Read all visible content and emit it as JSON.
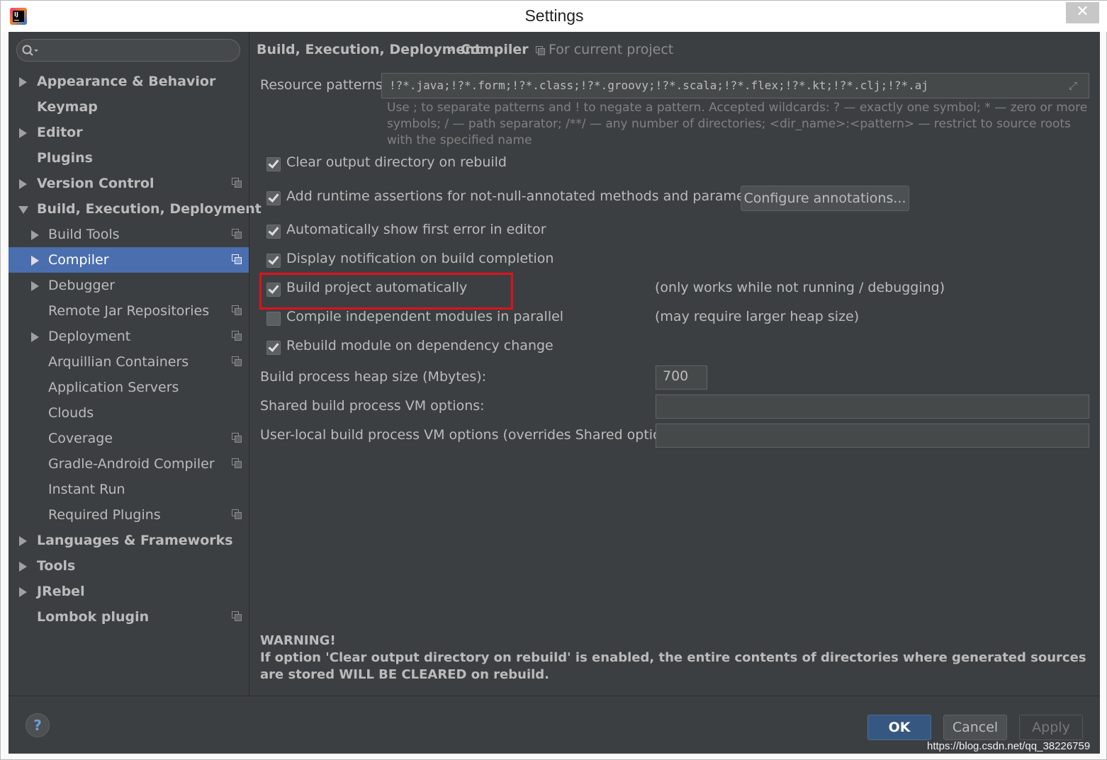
{
  "window": {
    "title": "Settings",
    "close_label": "✕"
  },
  "sidebar": {
    "search_placeholder": "",
    "items": [
      {
        "label": "Appearance & Behavior",
        "bold": true,
        "arrow": "right",
        "indent": 0,
        "proj": false
      },
      {
        "label": "Keymap",
        "bold": true,
        "arrow": "none",
        "indent": 0,
        "proj": false
      },
      {
        "label": "Editor",
        "bold": true,
        "arrow": "right",
        "indent": 0,
        "proj": false
      },
      {
        "label": "Plugins",
        "bold": true,
        "arrow": "none",
        "indent": 0,
        "proj": false
      },
      {
        "label": "Version Control",
        "bold": true,
        "arrow": "right",
        "indent": 0,
        "proj": true
      },
      {
        "label": "Build, Execution, Deployment",
        "bold": true,
        "arrow": "down",
        "indent": 0,
        "proj": false
      },
      {
        "label": "Build Tools",
        "bold": false,
        "arrow": "right",
        "indent": 1,
        "proj": true
      },
      {
        "label": "Compiler",
        "bold": false,
        "arrow": "right",
        "indent": 1,
        "proj": true,
        "selected": true
      },
      {
        "label": "Debugger",
        "bold": false,
        "arrow": "right",
        "indent": 1,
        "proj": false
      },
      {
        "label": "Remote Jar Repositories",
        "bold": false,
        "arrow": "none",
        "indent": 1,
        "proj": true
      },
      {
        "label": "Deployment",
        "bold": false,
        "arrow": "right",
        "indent": 1,
        "proj": true
      },
      {
        "label": "Arquillian Containers",
        "bold": false,
        "arrow": "none",
        "indent": 1,
        "proj": true
      },
      {
        "label": "Application Servers",
        "bold": false,
        "arrow": "none",
        "indent": 1,
        "proj": false
      },
      {
        "label": "Clouds",
        "bold": false,
        "arrow": "none",
        "indent": 1,
        "proj": false
      },
      {
        "label": "Coverage",
        "bold": false,
        "arrow": "none",
        "indent": 1,
        "proj": true
      },
      {
        "label": "Gradle-Android Compiler",
        "bold": false,
        "arrow": "none",
        "indent": 1,
        "proj": true
      },
      {
        "label": "Instant Run",
        "bold": false,
        "arrow": "none",
        "indent": 1,
        "proj": false
      },
      {
        "label": "Required Plugins",
        "bold": false,
        "arrow": "none",
        "indent": 1,
        "proj": true
      },
      {
        "label": "Languages & Frameworks",
        "bold": true,
        "arrow": "right",
        "indent": 0,
        "proj": false
      },
      {
        "label": "Tools",
        "bold": true,
        "arrow": "right",
        "indent": 0,
        "proj": false
      },
      {
        "label": "JRebel",
        "bold": true,
        "arrow": "right",
        "indent": 0,
        "proj": false
      },
      {
        "label": "Lombok plugin",
        "bold": true,
        "arrow": "none",
        "indent": 0,
        "proj": true
      }
    ]
  },
  "breadcrumb": {
    "parent": "Build, Execution, Deployment",
    "separator": "›",
    "current": "Compiler",
    "scope": "For current project"
  },
  "compiler": {
    "resource_patterns_label": "Resource patterns:",
    "resource_patterns_value": "!?*.java;!?*.form;!?*.class;!?*.groovy;!?*.scala;!?*.flex;!?*.kt;!?*.clj;!?*.aj",
    "resource_patterns_hint": "Use ; to separate patterns and ! to negate a pattern. Accepted wildcards: ? — exactly one symbol; * — zero or more symbols; / — path separator; /**/ — any number of directories; <dir_name>:<pattern> — restrict to source roots with the specified name",
    "options": {
      "clear_output": {
        "label": "Clear output directory on rebuild",
        "checked": true
      },
      "runtime_assertions": {
        "label": "Add runtime assertions for not-null-annotated methods and parameters",
        "checked": true
      },
      "show_first_error": {
        "label": "Automatically show first error in editor",
        "checked": true
      },
      "display_notification": {
        "label": "Display notification on build completion",
        "checked": true
      },
      "build_automatically": {
        "label": "Build project automatically",
        "checked": true,
        "note": "(only works while not running / debugging)"
      },
      "parallel_modules": {
        "label": "Compile independent modules in parallel",
        "checked": false,
        "note": "(may require larger heap size)"
      },
      "rebuild_on_dependency": {
        "label": "Rebuild module on dependency change",
        "checked": true
      }
    },
    "configure_annotations_label": "Configure annotations...",
    "heap_size_label": "Build process heap size (Mbytes):",
    "heap_size_value": "700",
    "shared_vm_label": "Shared build process VM options:",
    "shared_vm_value": "",
    "user_vm_label": "User-local build process VM options (overrides Shared options):",
    "user_vm_value": "",
    "warning_title": "WARNING!",
    "warning_text": "If option 'Clear output directory on rebuild' is enabled, the entire contents of directories where generated sources are stored WILL BE CLEARED on rebuild."
  },
  "footer": {
    "help_label": "?",
    "ok_label": "OK",
    "cancel_label": "Cancel",
    "apply_label": "Apply",
    "watermark": "https://blog.csdn.net/qq_38226759"
  },
  "colors": {
    "panel_bg": "#3c3f41",
    "selection": "#4b6eaf",
    "highlight_box": "#e0111b",
    "ok_button": "#365880"
  }
}
